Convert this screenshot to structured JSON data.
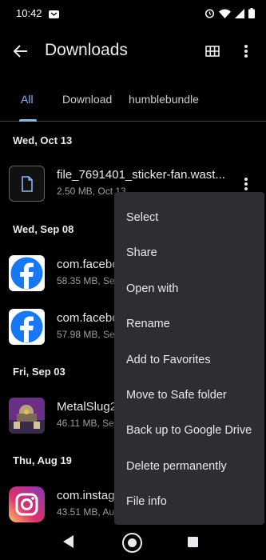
{
  "status_bar": {
    "time": "10:42"
  },
  "app_bar": {
    "title": "Downloads"
  },
  "tabs": [
    {
      "label": "All",
      "selected": true
    },
    {
      "label": "Download",
      "selected": false
    },
    {
      "label": "humblebundle",
      "selected": false
    }
  ],
  "sections": [
    {
      "date": "Wed, Oct 13"
    },
    {
      "date": "Wed, Sep 08"
    },
    {
      "date": "Fri, Sep 03"
    },
    {
      "date": "Thu, Aug 19"
    }
  ],
  "files": [
    {
      "name": "file_7691401_sticker-fan.wast...",
      "meta": "2.50 MB, Oct 13",
      "icon": "document-icon"
    },
    {
      "name": "com.facebo",
      "meta": "58.35 MB, Se",
      "icon": "facebook-icon"
    },
    {
      "name": "com.facebo",
      "meta": "57.98 MB, Se",
      "icon": "facebook-icon"
    },
    {
      "name": "MetalSlug2",
      "meta": "46.11 MB, Se",
      "icon": "metalslug-icon"
    },
    {
      "name": "com.instag",
      "meta": "43.51 MB, Au",
      "icon": "instagram-icon"
    }
  ],
  "menu": {
    "items": [
      "Select",
      "Share",
      "Open with",
      "Rename",
      "Add to Favorites",
      "Move to Safe folder",
      "Back up to Google Drive",
      "Delete permanently",
      "File info"
    ]
  },
  "colors": {
    "background": "#000000",
    "accent": "#8ab4f8",
    "menu_bg": "#2d2e31",
    "facebook": "#1877f2"
  }
}
